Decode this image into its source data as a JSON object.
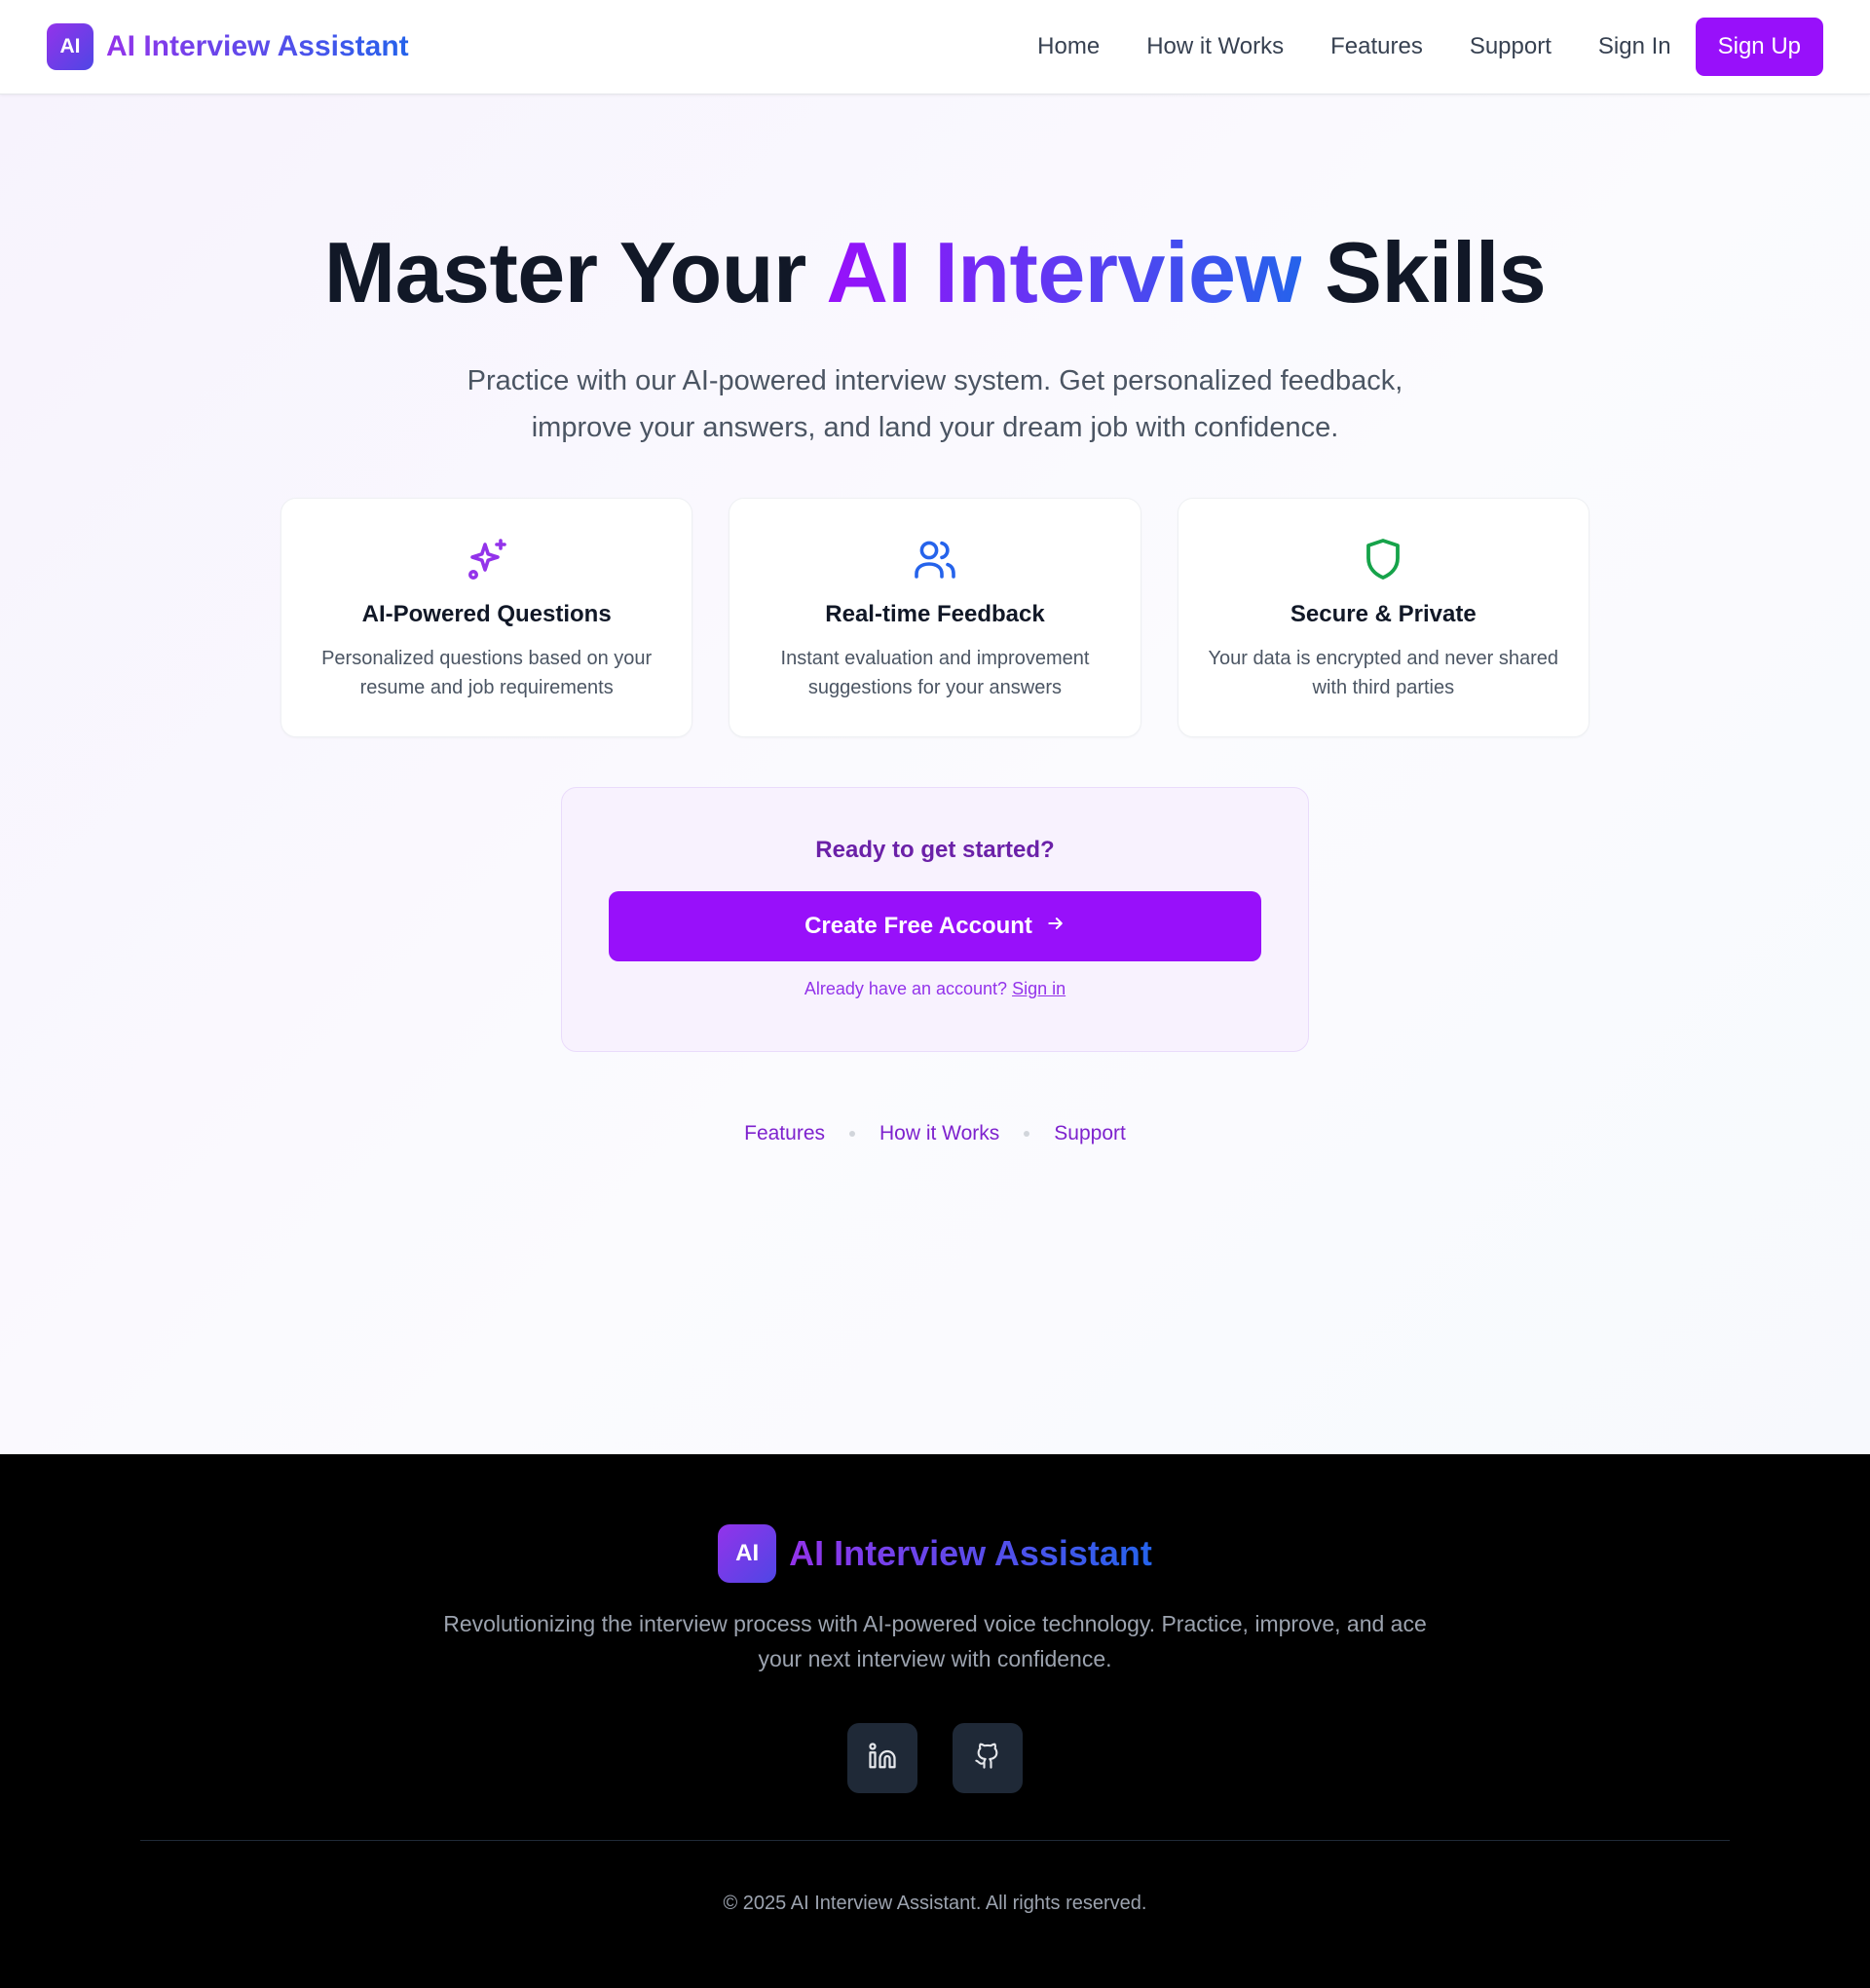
{
  "nav": {
    "logo_text": "AI",
    "brand": "AI Interview Assistant",
    "links": [
      "Home",
      "How it Works",
      "Features",
      "Support"
    ],
    "sign_in": "Sign In",
    "sign_up": "Sign Up"
  },
  "hero": {
    "title_part1": "Master Your ",
    "title_highlight": "AI Interview",
    "title_part2": " Skills",
    "subtitle": "Practice with our AI-powered interview system. Get personalized feedback, improve your answers, and land your dream job with confidence."
  },
  "features": [
    {
      "icon": "sparkles-icon",
      "title": "AI-Powered Questions",
      "desc": "Personalized questions based on your resume and job requirements"
    },
    {
      "icon": "users-icon",
      "title": "Real-time Feedback",
      "desc": "Instant evaluation and improvement suggestions for your answers"
    },
    {
      "icon": "shield-icon",
      "title": "Secure & Private",
      "desc": "Your data is encrypted and never shared with third parties"
    }
  ],
  "cta": {
    "title": "Ready to get started?",
    "button": "Create Free Account",
    "foot_text": "Already have an account?",
    "foot_link": "Sign in"
  },
  "sub_links": [
    "Features",
    "How it Works",
    "Support"
  ],
  "footer": {
    "logo_text": "AI",
    "brand": "AI Interview Assistant",
    "desc": "Revolutionizing the interview process with AI-powered voice technology. Practice, improve, and ace your next interview with confidence.",
    "socials": [
      "linkedin-icon",
      "github-icon"
    ],
    "copyright": "© 2025 AI Interview Assistant. All rights reserved."
  },
  "colors": {
    "accent": "#9810fa",
    "gradient_start": "#9333ea",
    "gradient_end": "#2563eb",
    "icon_purple": "#9333ea",
    "icon_blue": "#2563eb",
    "icon_green": "#16a34a"
  }
}
